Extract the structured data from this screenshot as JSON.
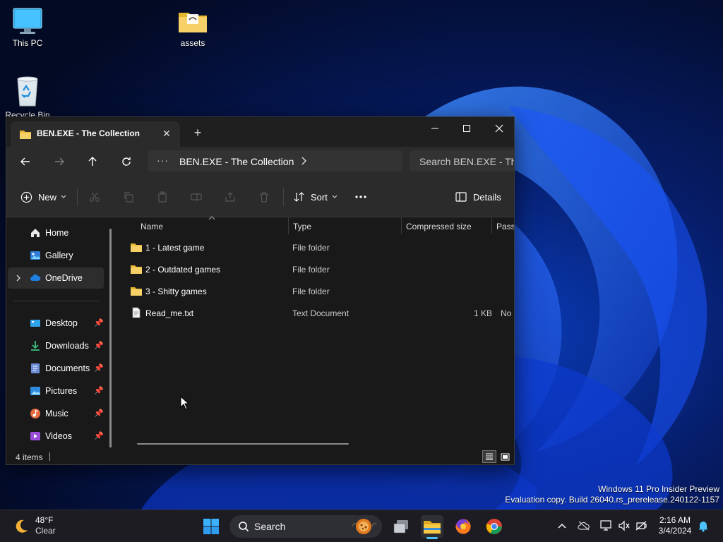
{
  "desktop": {
    "icons": [
      {
        "label": "This PC"
      },
      {
        "label": "assets"
      },
      {
        "label": "Recycle Bin"
      }
    ],
    "watermark": {
      "line1": "Windows 11 Pro Insider Preview",
      "line2": "Evaluation copy. Build 26040.rs_prerelease.240122-1157"
    }
  },
  "explorer": {
    "tab_title": "BEN.EXE - The Collection",
    "breadcrumb": "BEN.EXE - The Collection",
    "search_placeholder": "Search BEN.EXE - The Collection",
    "commands": {
      "new_label": "New",
      "sort_label": "Sort",
      "details_label": "Details"
    },
    "nav_items": [
      {
        "label": "Home",
        "icon": "home-icon"
      },
      {
        "label": "Gallery",
        "icon": "gallery-icon"
      },
      {
        "label": "OneDrive",
        "icon": "cloud-icon"
      },
      {
        "label": "Desktop",
        "icon": "desktop-icon"
      },
      {
        "label": "Downloads",
        "icon": "download-icon"
      },
      {
        "label": "Documents",
        "icon": "document-icon"
      },
      {
        "label": "Pictures",
        "icon": "pictures-icon"
      },
      {
        "label": "Music",
        "icon": "music-icon"
      },
      {
        "label": "Videos",
        "icon": "videos-icon"
      }
    ],
    "columns": [
      "Name",
      "Type",
      "Compressed size",
      "Passw"
    ],
    "files": [
      {
        "name": "1 - Latest game",
        "type": "File folder",
        "size": "",
        "password": "",
        "kind": "folder"
      },
      {
        "name": "2 - Outdated games",
        "type": "File folder",
        "size": "",
        "password": "",
        "kind": "folder"
      },
      {
        "name": "3 - Shitty games",
        "type": "File folder",
        "size": "",
        "password": "",
        "kind": "folder"
      },
      {
        "name": "Read_me.txt",
        "type": "Text Document",
        "size": "1 KB",
        "password": "No",
        "kind": "file"
      }
    ],
    "status": "4 items"
  },
  "taskbar": {
    "weather": {
      "temp": "48°F",
      "condition": "Clear"
    },
    "search_label": "Search",
    "clock": {
      "time": "2:16 AM",
      "date": "3/4/2024"
    }
  },
  "colors": {
    "accent": "#4cc2ff",
    "folder": "#f5c542",
    "window_bg": "#191919",
    "toolbar_bg": "#2b2b2b"
  }
}
